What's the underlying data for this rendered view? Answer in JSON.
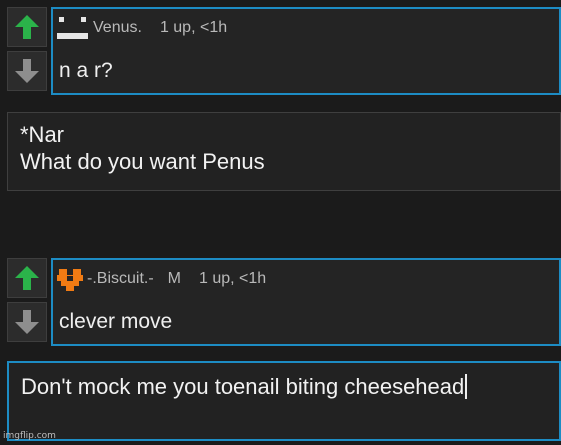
{
  "comments": [
    {
      "username": "Venus.",
      "badge": "",
      "meta": "1 up, <1h",
      "text": "n a r?",
      "avatar": "block-face-icon"
    },
    {
      "username": "-.Biscuit.-",
      "badge": "M",
      "meta": "1 up, <1h",
      "text": "clever move",
      "avatar": "orange-pixel-heart-icon"
    }
  ],
  "replies": [
    {
      "lines": [
        "*Nar",
        "What do you want Penus"
      ]
    },
    {
      "value": "Don't mock me you toenail biting cheesehead"
    }
  ],
  "watermark": "imgflip.com",
  "colors": {
    "upvote": "#2bb34a",
    "downvote": "#8e8e8e",
    "accent": "#1d8cc4",
    "biscuit_avatar": "#f07b14"
  }
}
